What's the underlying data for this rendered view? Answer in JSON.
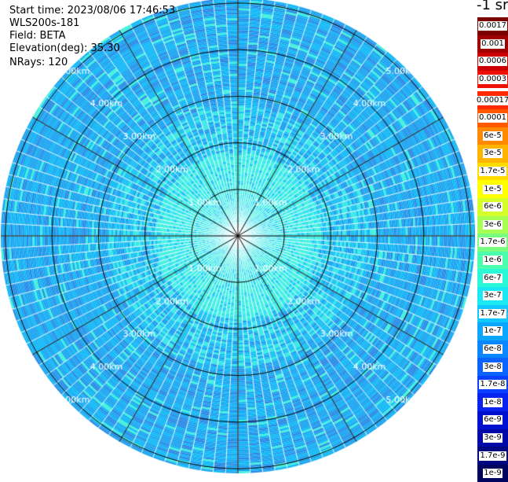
{
  "header": {
    "start_time": "Start time: 2023/08/06 17:46:53",
    "instrument": "WLS200s-181",
    "field": "Field: BETA",
    "elevation": "Elevation(deg): 35.30",
    "nrays": "NRays: 120"
  },
  "units_label": "-1 sr",
  "chart_data": {
    "type": "heatmap",
    "projection": "polar-ppi",
    "field": "BETA",
    "n_rays": 120,
    "range_rings_km": [
      1,
      2,
      3,
      4,
      5
    ],
    "range_ring_labels": [
      "1.00km",
      "2.00km",
      "3.00km",
      "4.00km",
      "5.00km"
    ],
    "spokes_deg": [
      0,
      30,
      60,
      90,
      120,
      150,
      180,
      210,
      240,
      270,
      300,
      330
    ],
    "pattern_note_color_center": "#40f0e0",
    "colorbar": {
      "scale": "log",
      "labels": [
        "0.0017",
        "0.001",
        "0.0006",
        "0.0003",
        "0.00017",
        "0.0001",
        "6e-5",
        "3e-5",
        "1.7e-5",
        "1e-5",
        "6e-6",
        "3e-6",
        "1.7e-6",
        "1e-6",
        "6e-7",
        "3e-7",
        "1.7e-7",
        "1e-7",
        "6e-8",
        "3e-8",
        "1.7e-8",
        "1e-8",
        "6e-9",
        "3e-9",
        "1.7e-9",
        "1e-9"
      ],
      "colors": [
        "#7a0000",
        "#a00000",
        "#cc0000",
        "#ee1000",
        "#ff2a00",
        "#ff5a00",
        "#ff8a00",
        "#ffb400",
        "#ffdc00",
        "#ffff00",
        "#d4ff2a",
        "#a6ff52",
        "#78ff80",
        "#4cffac",
        "#2af8d6",
        "#1ce8f4",
        "#10c8ff",
        "#0aa6ff",
        "#0a86ff",
        "#0a62ff",
        "#0a40ff",
        "#0a22f0",
        "#0010d0",
        "#0008a8",
        "#000680",
        "#00045c"
      ],
      "gap_after_index": 3
    }
  }
}
